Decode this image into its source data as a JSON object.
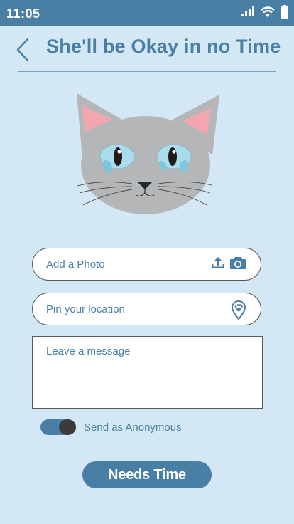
{
  "status_bar": {
    "time": "11:05"
  },
  "header": {
    "title": "She'll be Okay in no Time"
  },
  "form": {
    "photo_placeholder": "Add a Photo",
    "location_placeholder": "Pin your location",
    "message_placeholder": "Leave a message",
    "anonymous_label": "Send as Anonymous",
    "anonymous_on": true,
    "submit_label": "Needs Time"
  },
  "colors": {
    "accent": "#4a7fa5",
    "background": "#d3e7f4",
    "cat_fur": "#b5b6b8",
    "cat_ear_inner": "#f4a6b0",
    "cat_eye": "#a9ddec"
  },
  "icons": [
    "signal-icon",
    "wifi-icon",
    "battery-icon",
    "back-chevron-icon",
    "upload-icon",
    "camera-icon",
    "location-pin-icon"
  ]
}
